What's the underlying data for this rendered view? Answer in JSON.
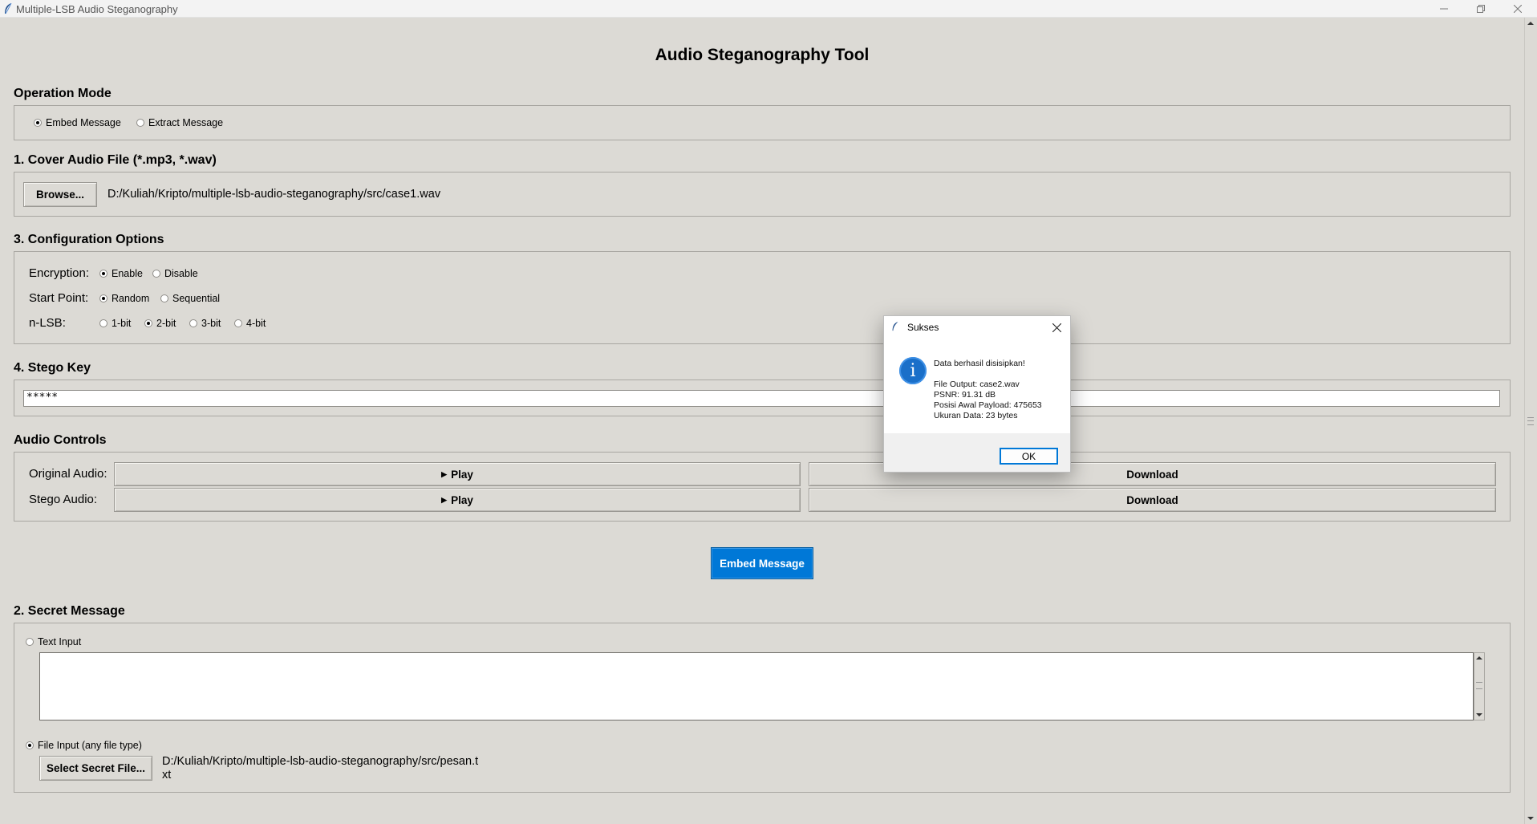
{
  "window": {
    "title": "Multiple-LSB Audio Steganography",
    "minimize_icon": "minimize-icon",
    "restore_icon": "restore-icon",
    "close_icon": "close-icon"
  },
  "app_title": "Audio Steganography Tool",
  "operation_mode": {
    "title": "Operation Mode",
    "options": [
      {
        "label": "Embed Message",
        "selected": true
      },
      {
        "label": "Extract Message",
        "selected": false
      }
    ]
  },
  "cover_audio": {
    "title": "1. Cover Audio File (*.mp3, *.wav)",
    "browse_label": "Browse...",
    "path": "D:/Kuliah/Kripto/multiple-lsb-audio-steganography/src/case1.wav"
  },
  "config": {
    "title": "3. Configuration Options",
    "encryption": {
      "label": "Encryption:",
      "options": [
        {
          "label": "Enable",
          "selected": true
        },
        {
          "label": "Disable",
          "selected": false
        }
      ]
    },
    "start_point": {
      "label": "Start Point:",
      "options": [
        {
          "label": "Random",
          "selected": true
        },
        {
          "label": "Sequential",
          "selected": false
        }
      ]
    },
    "nlsb": {
      "label": "n-LSB:",
      "options": [
        {
          "label": "1-bit",
          "selected": false
        },
        {
          "label": "2-bit",
          "selected": true
        },
        {
          "label": "3-bit",
          "selected": false
        },
        {
          "label": "4-bit",
          "selected": false
        }
      ]
    }
  },
  "stego_key": {
    "title": "4. Stego Key",
    "value": "*****"
  },
  "audio_controls": {
    "title": "Audio Controls",
    "original_label": "Original Audio:",
    "stego_label": "Stego Audio:",
    "play_label": "Play",
    "download_label": "Download"
  },
  "embed_button": "Embed Message",
  "secret_message": {
    "title": "2. Secret Message",
    "text_input_label": "Text Input",
    "text_value": "",
    "file_input_label": "File Input (any file type)",
    "select_file_label": "Select Secret File...",
    "file_path_line1": "D:/Kuliah/Kripto/multiple-lsb-audio-steganography/src/pesan.t",
    "file_path_line2": "xt"
  },
  "dialog": {
    "title": "Sukses",
    "icon": "info-icon",
    "headline": "Data berhasil disisipkan!",
    "line1": "File Output: case2.wav",
    "line2": "PSNR: 91.31 dB",
    "line3": "Posisi Awal Payload: 475653",
    "line4": "Ukuran Data: 23 bytes",
    "ok_label": "OK"
  },
  "colors": {
    "background": "#dcdad5",
    "accent": "#0078d7",
    "info_icon": "#1a6fc9"
  }
}
